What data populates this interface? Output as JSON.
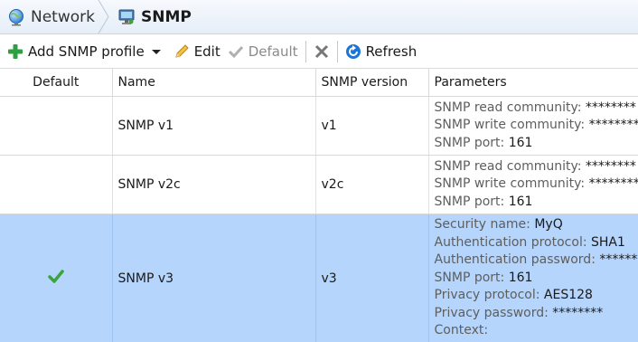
{
  "breadcrumb": {
    "items": [
      {
        "label": "Network",
        "icon": "globe-icon"
      },
      {
        "label": "SNMP",
        "icon": "monitor-icon"
      }
    ]
  },
  "toolbar": {
    "add_label": "Add SNMP profile",
    "edit_label": "Edit",
    "default_label": "Default",
    "refresh_label": "Refresh"
  },
  "table": {
    "columns": [
      "Default",
      "Name",
      "SNMP version",
      "Parameters"
    ],
    "rows": [
      {
        "default": false,
        "name": "SNMP v1",
        "version": "v1",
        "params": [
          {
            "key": "SNMP read community:",
            "value": "********"
          },
          {
            "key": "SNMP write community:",
            "value": "********"
          },
          {
            "key": "SNMP port:",
            "value": "161"
          }
        ]
      },
      {
        "default": false,
        "name": "SNMP v2c",
        "version": "v2c",
        "params": [
          {
            "key": "SNMP read community:",
            "value": "********"
          },
          {
            "key": "SNMP write community:",
            "value": "********"
          },
          {
            "key": "SNMP port:",
            "value": "161"
          }
        ]
      },
      {
        "default": true,
        "selected": true,
        "name": "SNMP v3",
        "version": "v3",
        "params": [
          {
            "key": "Security name:",
            "value": "MyQ"
          },
          {
            "key": "Authentication protocol:",
            "value": "SHA1"
          },
          {
            "key": "Authentication password:",
            "value": "********"
          },
          {
            "key": "SNMP port:",
            "value": "161"
          },
          {
            "key": "Privacy protocol:",
            "value": "AES128"
          },
          {
            "key": "Privacy password:",
            "value": "********"
          },
          {
            "key": "Context:",
            "value": ""
          }
        ]
      }
    ]
  },
  "colors": {
    "selection": "#b5d5fc",
    "check": "#3aa63a",
    "add": "#2ea043",
    "refresh": "#1c74d4"
  }
}
